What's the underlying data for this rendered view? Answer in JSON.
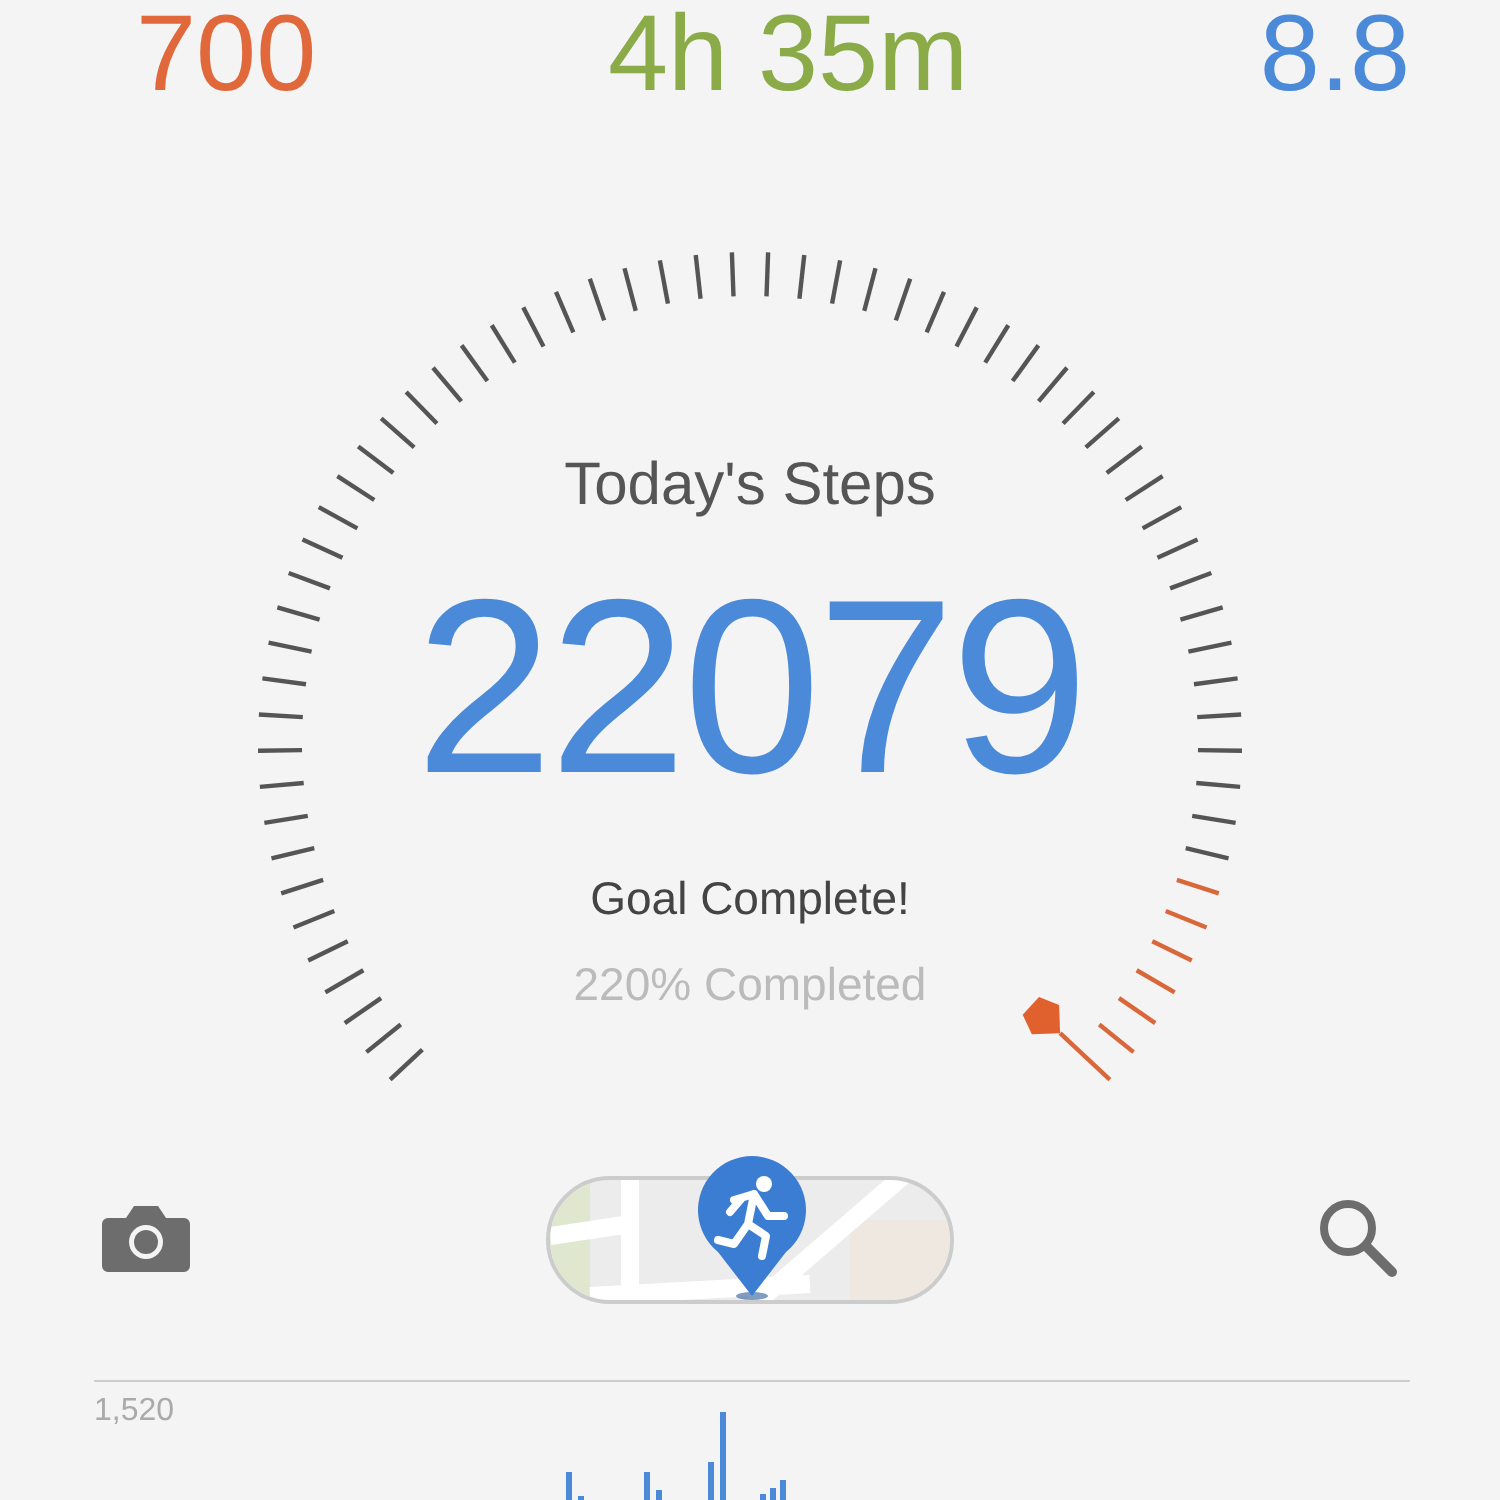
{
  "stats": [
    {
      "value": "700",
      "color": "#e0683a"
    },
    {
      "value": "4h 35m",
      "color": "#8aab48"
    },
    {
      "value": "8.8",
      "color": "#4a8ad8"
    }
  ],
  "gauge": {
    "title": "Today's Steps",
    "steps": "22079",
    "status": "Goal Complete!",
    "progress": "220% Completed"
  },
  "chart": {
    "max_label": "1,520"
  }
}
